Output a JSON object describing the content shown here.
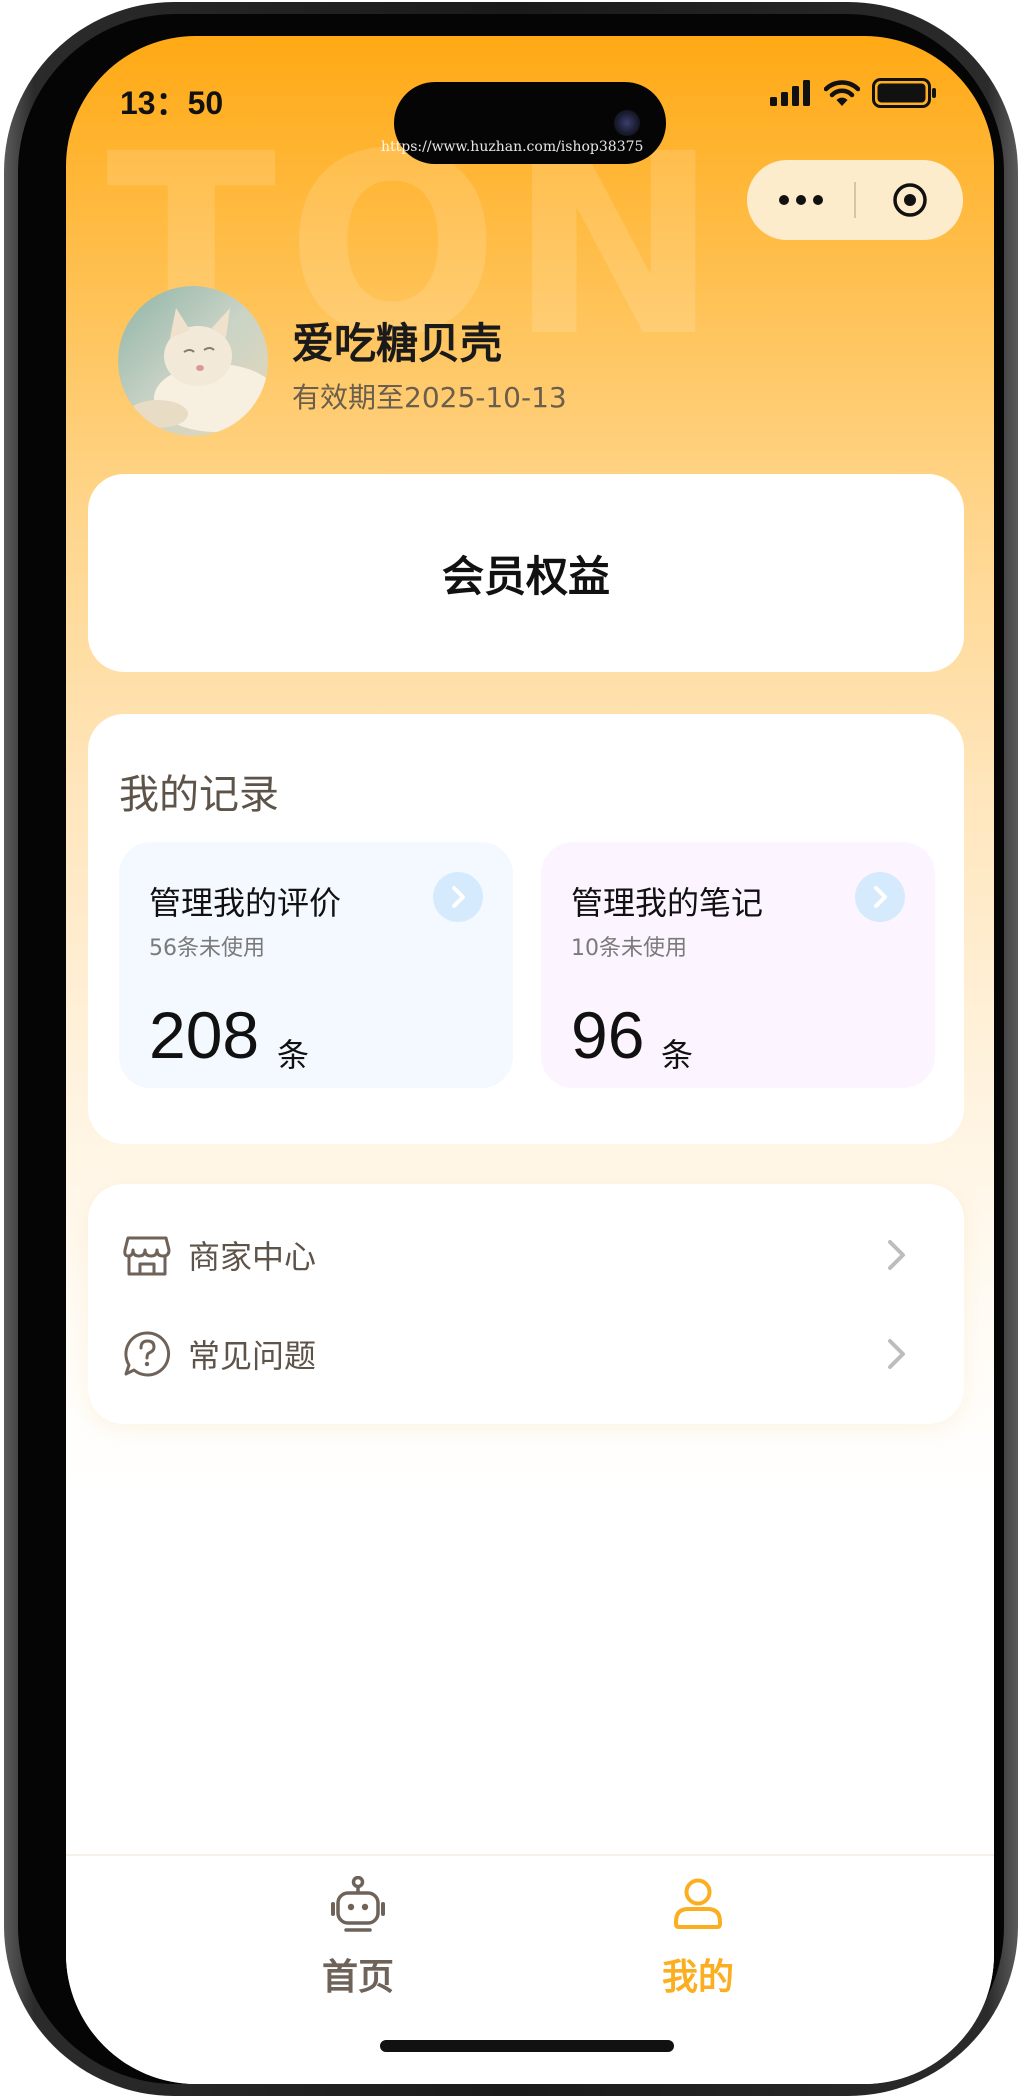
{
  "status_bar": {
    "time": "13：50"
  },
  "watermark": {
    "background_text": "TON",
    "url": "https://www.huzhan.com/ishop38375"
  },
  "capsule": {
    "more_icon": "more-dots-icon",
    "close_icon": "target-circle-icon"
  },
  "profile": {
    "name": "爱吃糖贝壳",
    "expiry": "有效期至2025-10-13"
  },
  "member": {
    "title": "会员权益"
  },
  "records": {
    "title": "我的记录",
    "cards": [
      {
        "title": "管理我的评价",
        "sub": "56条未使用",
        "value": "208",
        "unit": "条",
        "bg_color": "#f3f9ff"
      },
      {
        "title": "管理我的笔记",
        "sub": "10条未使用",
        "value": "96",
        "unit": "条",
        "bg_color": "#fcf4fe"
      }
    ]
  },
  "menu": {
    "items": [
      {
        "label": "商家中心",
        "icon": "store-icon"
      },
      {
        "label": "常见问题",
        "icon": "help-bubble-icon"
      }
    ]
  },
  "tabbar": {
    "tabs": [
      {
        "label": "首页",
        "icon": "robot-icon",
        "active": false
      },
      {
        "label": "我的",
        "icon": "user-icon",
        "active": true
      }
    ],
    "active_color": "#fbae1f",
    "inactive_color": "#6e6259"
  },
  "colors": {
    "header_gradient_top": "#ffa914",
    "arrow_badge": "#d6eafd"
  }
}
